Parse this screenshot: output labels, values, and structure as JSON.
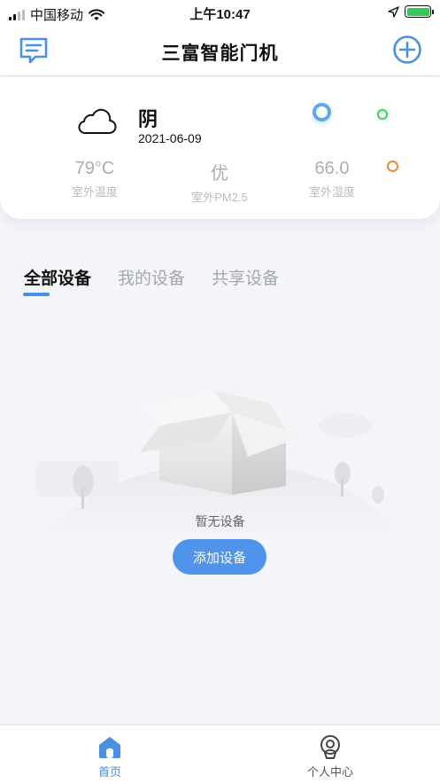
{
  "status_bar": {
    "carrier": "中国移动",
    "time": "上午10:47",
    "icons": [
      "signal-icon",
      "wifi-icon",
      "location-icon",
      "battery-charging-icon"
    ]
  },
  "nav": {
    "title": "三富智能门机",
    "left_icon": "message-icon",
    "right_icon": "add-circle-icon",
    "accent": "#4a90e2"
  },
  "weather": {
    "condition": "阴",
    "date": "2021-06-09",
    "icon": "cloud-icon",
    "metrics": [
      {
        "value": "79°C",
        "label": "室外温度"
      },
      {
        "value": "优",
        "label": "室外PM2.5"
      },
      {
        "value": "66.0",
        "label": "室外湿度"
      }
    ],
    "indicator_colors": [
      "#5aa7f2",
      "#3ad25a",
      "#f08a2a"
    ]
  },
  "tabs": [
    {
      "label": "全部设备",
      "active": true
    },
    {
      "label": "我的设备",
      "active": false
    },
    {
      "label": "共享设备",
      "active": false
    }
  ],
  "empty_state": {
    "text": "暂无设备",
    "button_label": "添加设备",
    "button_color": "#4f93ea"
  },
  "bottom_nav": [
    {
      "label": "首页",
      "icon": "home-icon",
      "active": true
    },
    {
      "label": "个人中心",
      "icon": "profile-icon",
      "active": false
    }
  ]
}
